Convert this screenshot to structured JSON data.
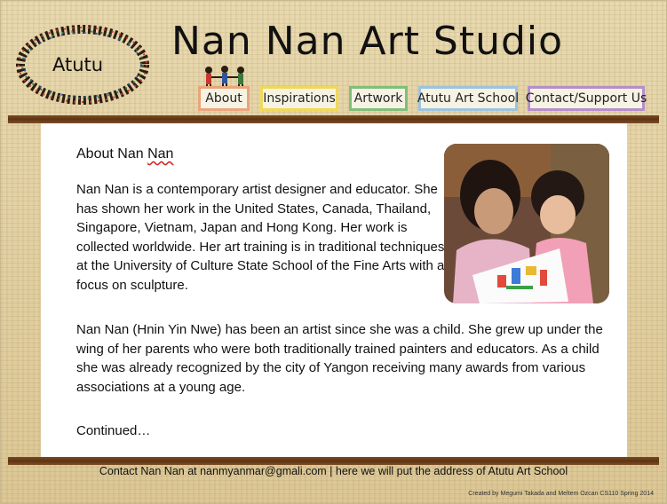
{
  "logo": {
    "text": "Atutu"
  },
  "site": {
    "title": "Nan Nan Art Studio"
  },
  "nav": {
    "items": [
      {
        "label": "About",
        "color": "#e9a57b"
      },
      {
        "label": "Inspirations",
        "color": "#f0d85a"
      },
      {
        "label": "Artwork",
        "color": "#7fbf7a"
      },
      {
        "label": "Atutu Art School",
        "color": "#9cc4dd"
      },
      {
        "label": "Contact/Support Us",
        "color": "#b48fc9"
      }
    ]
  },
  "main": {
    "heading_prefix": "About Nan ",
    "heading_suffix": "Nan",
    "paragraph1": "Nan Nan is a contemporary artist designer and educator. She has shown her work in the United States, Canada, Thailand, Singapore, Vietnam, Japan and Hong Kong. Her work is collected worldwide. Her art training is in traditional techniques at the University of Culture State School of the Fine Arts with a focus on sculpture.",
    "paragraph2": "Nan Nan (Hnin Yin Nwe) has been an artist since she was a child. She grew up under the wing of her parents who were both traditionally trained painters and educators. As a child she was already recognized by the city of Yangon receiving many awards from various associations at a young age.",
    "continued": "Continued…"
  },
  "footer": {
    "contact": "Contact Nan Nan at nanmyanmar@gmali.com | here we will put the address of Atutu Art School",
    "credit": "Created by Megumi Takada and Meltem Ozcan  CS110 Spring 2014"
  }
}
